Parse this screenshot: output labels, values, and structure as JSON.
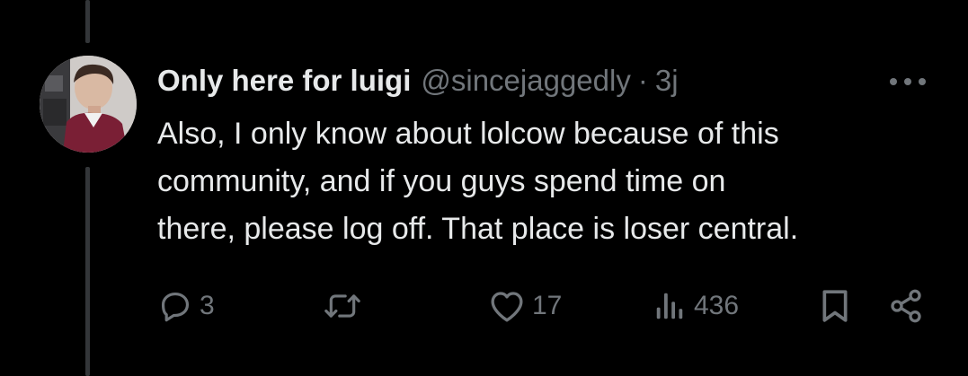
{
  "tweet": {
    "author": {
      "display_name": "Only here for luigi",
      "handle": "@sincejaggedly",
      "separator": "·",
      "time": "3j"
    },
    "text": "Also, I only know about lolcow because of this\ncommunity, and if you guys spend time on\nthere, please log off. That place is loser central.",
    "actions": {
      "replies": "3",
      "reposts": "",
      "likes": "17",
      "views": "436"
    }
  },
  "icons": {
    "more": "more-horizontal-icon",
    "reply": "reply-icon",
    "repost": "repost-icon",
    "like": "heart-icon",
    "views": "analytics-icon",
    "bookmark": "bookmark-icon",
    "share": "share-icon"
  },
  "colors": {
    "background": "#000000",
    "primary_text": "#e7e9ea",
    "secondary_text": "#71767b",
    "thread_line": "#333639"
  }
}
